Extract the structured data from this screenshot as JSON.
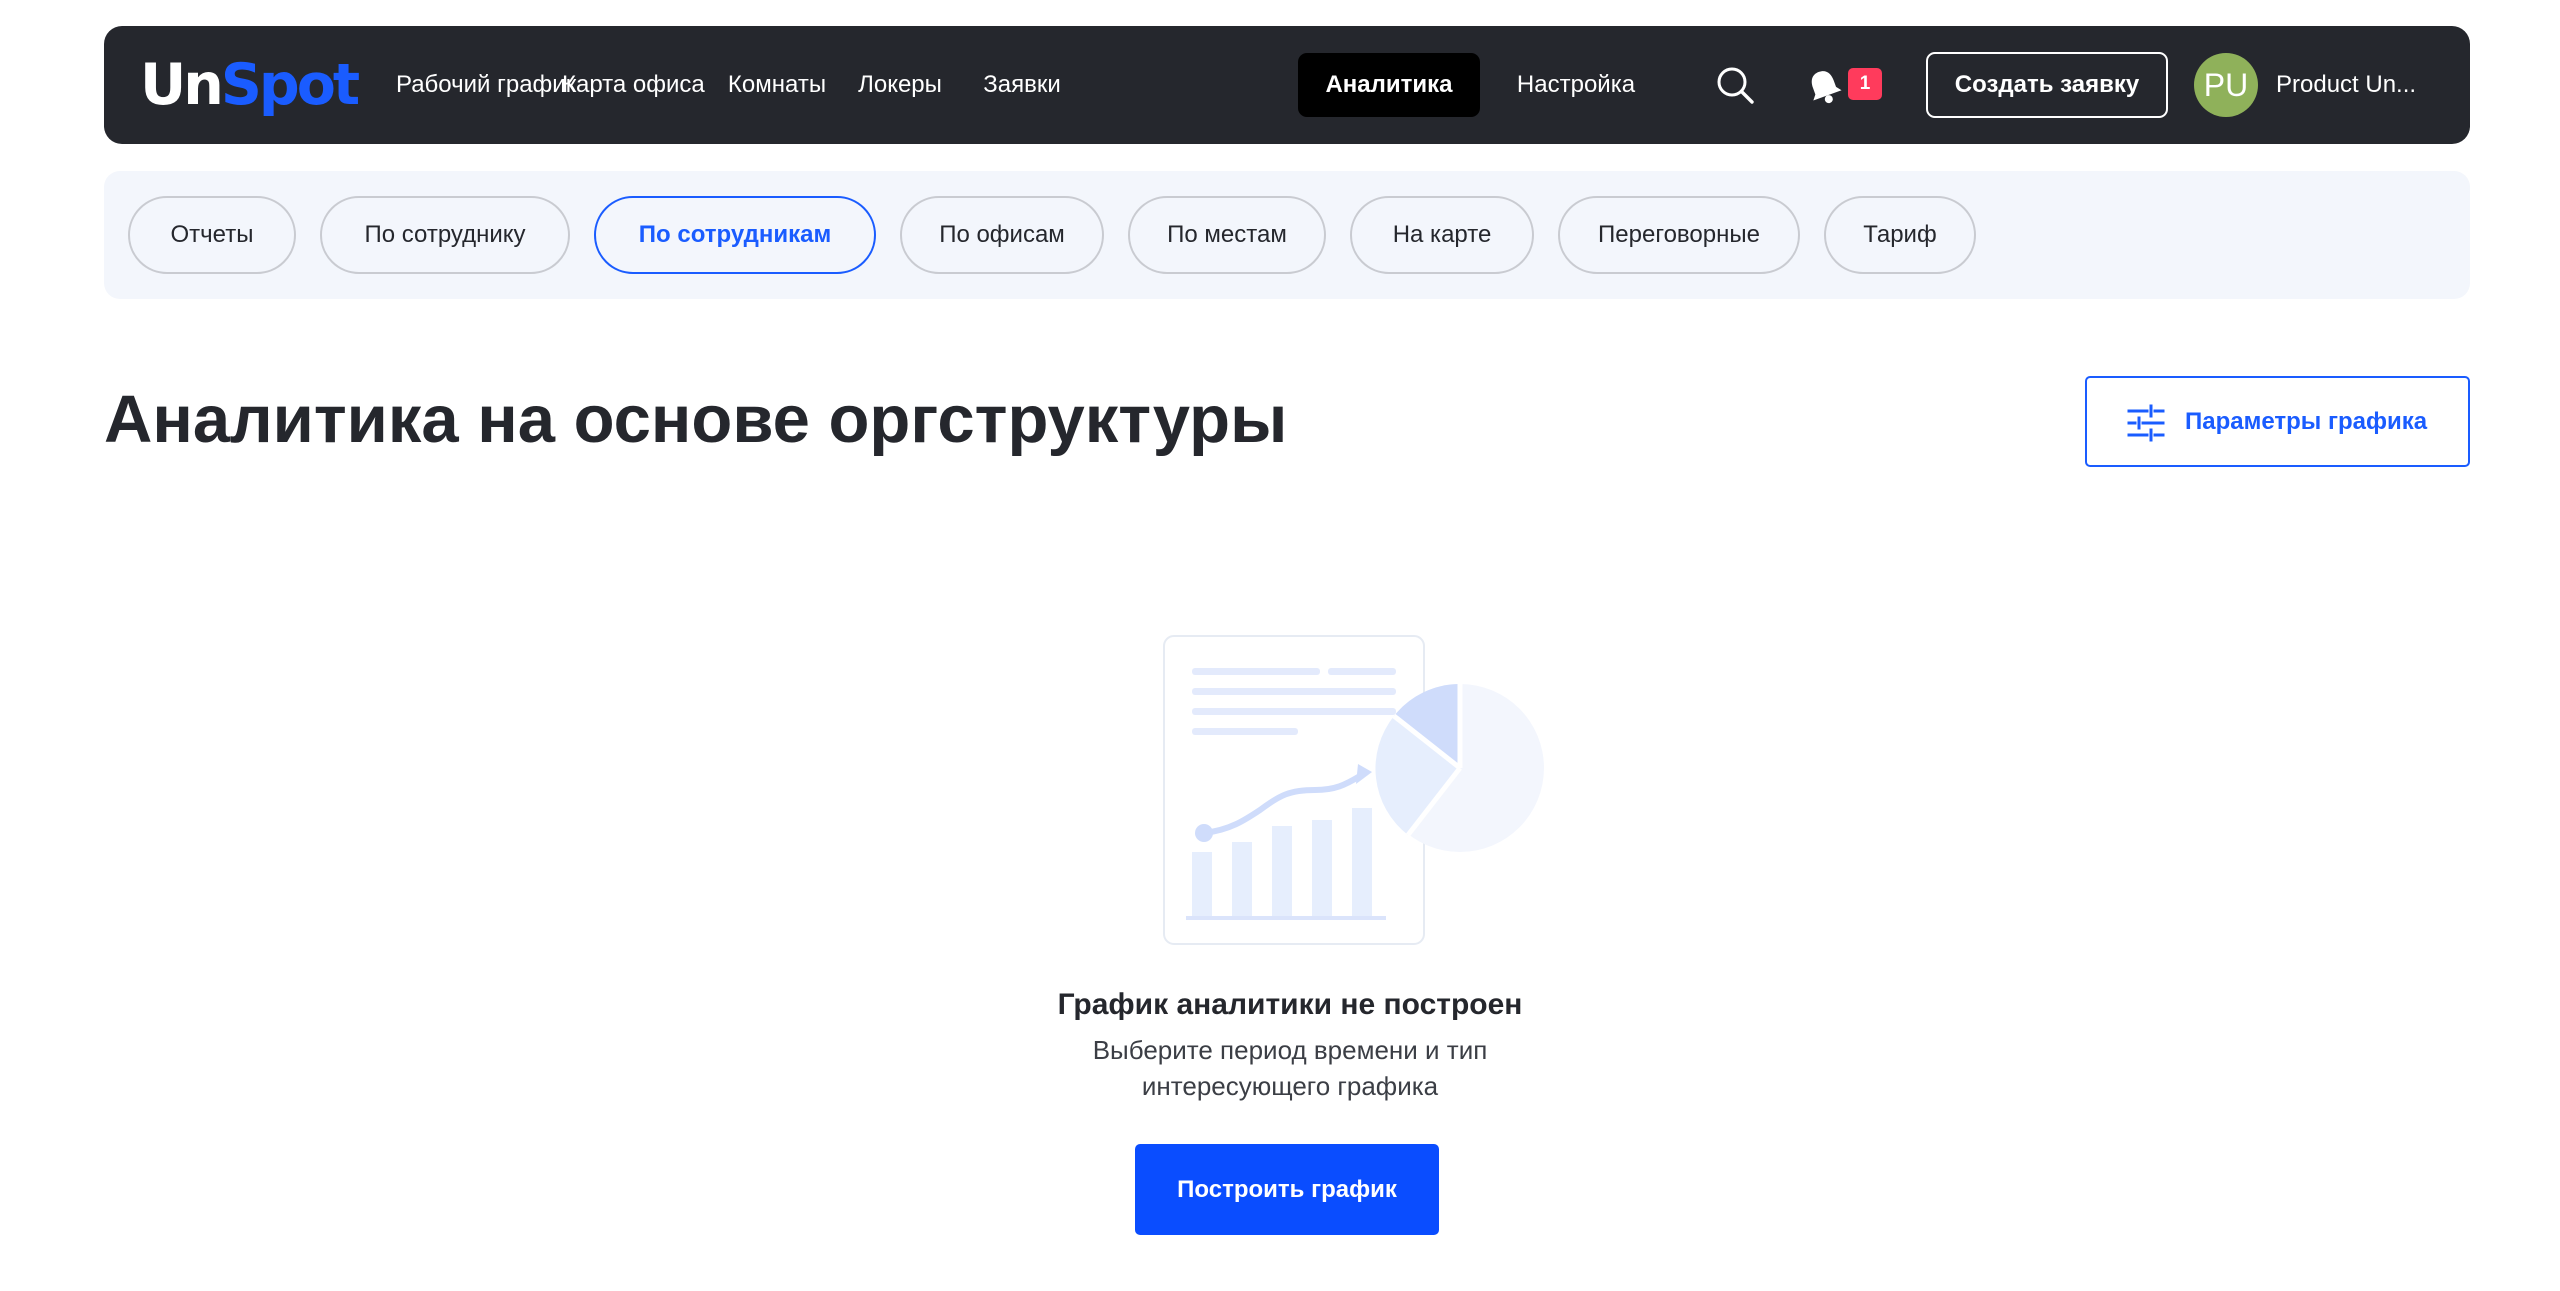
{
  "logo": {
    "part1": "Un",
    "part2": "Spot"
  },
  "nav": {
    "items": [
      {
        "label": "Рабочий график"
      },
      {
        "label": "Карта офиса"
      },
      {
        "label": "Комнаты"
      },
      {
        "label": "Локеры"
      },
      {
        "label": "Заявки"
      },
      {
        "label": "Аналитика",
        "active": true
      },
      {
        "label": "Настройка"
      }
    ],
    "notification_count": "1",
    "create_button": "Создать заявку",
    "user": {
      "initials": "PU",
      "name": "Product Un..."
    }
  },
  "subtabs": [
    {
      "label": "Отчеты"
    },
    {
      "label": "По сотруднику"
    },
    {
      "label": "По сотрудникам",
      "active": true
    },
    {
      "label": "По офисам"
    },
    {
      "label": "По местам"
    },
    {
      "label": "На карте"
    },
    {
      "label": "Переговорные"
    },
    {
      "label": "Тариф"
    }
  ],
  "page": {
    "title": "Аналитика на основе оргструктуры",
    "params_button": "Параметры графика"
  },
  "empty_state": {
    "title": "График аналитики не построен",
    "subtitle": "Выберите период времени и тип интересующего графика",
    "button": "Построить график"
  },
  "colors": {
    "accent": "#1a5cff",
    "topbar": "#25272d",
    "badge": "#ff3b5c",
    "avatar": "#8fb15a",
    "subtabs_bg": "#f3f6fc"
  }
}
